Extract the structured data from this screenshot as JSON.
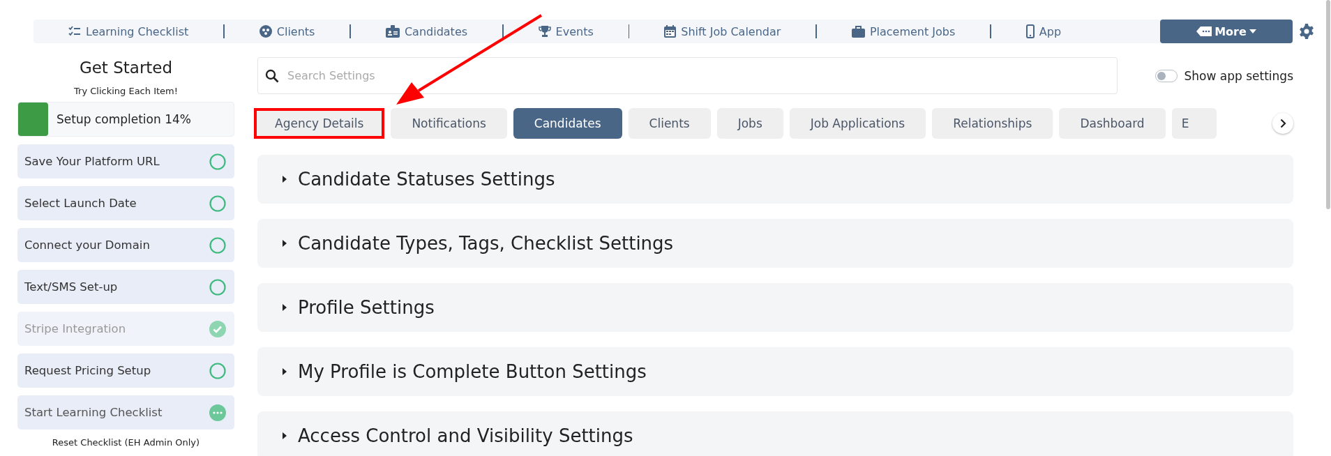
{
  "nav": {
    "items": [
      {
        "label": "Learning Checklist"
      },
      {
        "label": "Clients"
      },
      {
        "label": "Candidates"
      },
      {
        "label": "Events"
      },
      {
        "label": "Shift Job Calendar"
      },
      {
        "label": "Placement Jobs"
      },
      {
        "label": "App"
      }
    ],
    "more": "More"
  },
  "sidebar": {
    "title": "Get Started",
    "subtitle": "Try Clicking Each Item!",
    "progress": {
      "label": "Setup completion 14%",
      "level": 0.14
    },
    "items": [
      {
        "label": "Save Your Platform URL",
        "kind": "todo"
      },
      {
        "label": "Select Launch Date",
        "kind": "todo"
      },
      {
        "label": "Connect your Domain",
        "kind": "todo"
      },
      {
        "label": "Text/SMS Set-up",
        "kind": "todo"
      },
      {
        "label": "Stripe Integration",
        "kind": "done"
      },
      {
        "label": "Request Pricing Setup",
        "kind": "todo"
      },
      {
        "label": "Start Learning Checklist",
        "kind": "started"
      }
    ],
    "reset": "Reset Checklist (EH Admin Only)"
  },
  "search": {
    "placeholder": "Search Settings"
  },
  "app_toggle": {
    "label": "Show app settings",
    "on": false
  },
  "tabs": [
    {
      "label": "Agency Details",
      "selected": false,
      "highlighted": true
    },
    {
      "label": "Notifications",
      "selected": false,
      "highlighted": false
    },
    {
      "label": "Candidates",
      "selected": true,
      "highlighted": false
    },
    {
      "label": "Clients",
      "selected": false,
      "highlighted": false
    },
    {
      "label": "Jobs",
      "selected": false,
      "highlighted": false
    },
    {
      "label": "Job Applications",
      "selected": false,
      "highlighted": false
    },
    {
      "label": "Relationships",
      "selected": false,
      "highlighted": false
    },
    {
      "label": "Dashboard",
      "selected": false,
      "highlighted": false
    },
    {
      "label": "E",
      "selected": false,
      "highlighted": false
    }
  ],
  "sections": [
    {
      "title": "Candidate Statuses Settings",
      "expanded": false
    },
    {
      "title": "Candidate Types, Tags, Checklist Settings",
      "expanded": false
    },
    {
      "title": "Profile Settings",
      "expanded": false
    },
    {
      "title": "My Profile is Complete Button Settings",
      "expanded": false
    },
    {
      "title": "Access Control and Visibility Settings",
      "expanded": false
    }
  ]
}
